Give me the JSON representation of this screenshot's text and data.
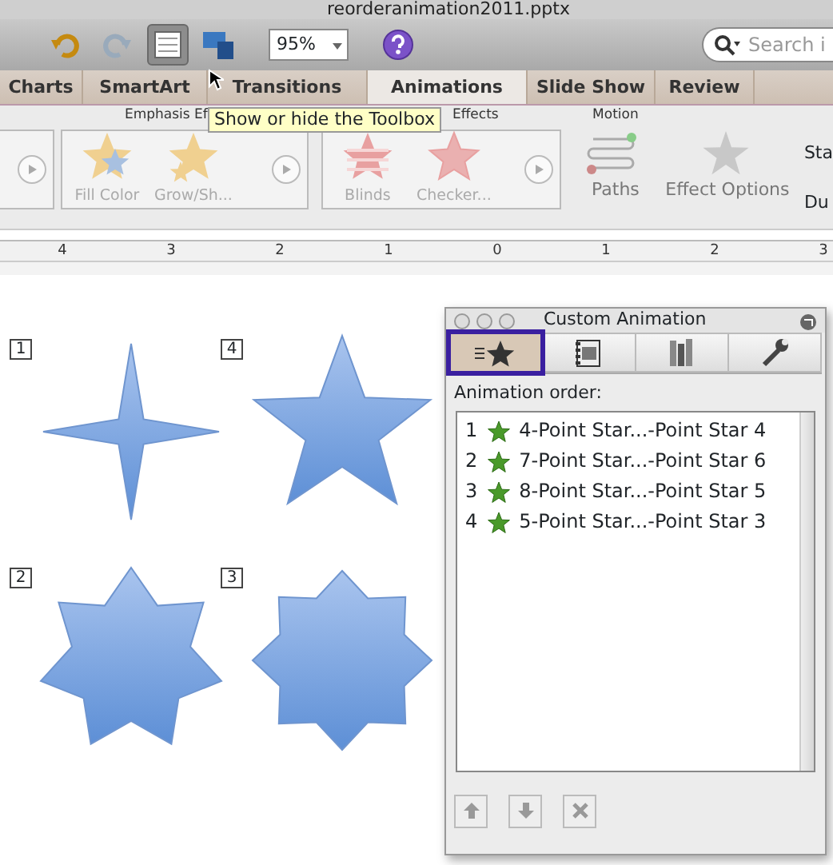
{
  "window": {
    "title": "reorderanimation2011.pptx"
  },
  "toolbar": {
    "zoom": "95%",
    "search": {
      "placeholder": "Search i"
    },
    "toolbox_pressed": true
  },
  "tooltip": "Show or hide the Toolbox",
  "tabs": [
    {
      "label": "Charts",
      "selected": false
    },
    {
      "label": "SmartArt",
      "selected": false
    },
    {
      "label": "Transitions",
      "selected": false
    },
    {
      "label": "Animations",
      "selected": true
    },
    {
      "label": "Slide Show",
      "selected": false
    },
    {
      "label": "Review",
      "selected": false
    }
  ],
  "ribbon": {
    "groups": [
      {
        "title": "Emphasis Ef",
        "items": [
          {
            "label": "Fill Color",
            "kind": "fill"
          },
          {
            "label": "Grow/Sh...",
            "kind": "grow"
          }
        ]
      },
      {
        "title": "Effects",
        "items": [
          {
            "label": "Blinds",
            "kind": "blinds"
          },
          {
            "label": "Checker...",
            "kind": "checker"
          }
        ]
      }
    ],
    "motion": {
      "title": "Motion",
      "button": "Paths"
    },
    "effect_options": "Effect Options",
    "side_labels": [
      "Sta",
      "Du"
    ]
  },
  "ruler": [
    "4",
    "3",
    "2",
    "1",
    "0",
    "1",
    "2",
    "3"
  ],
  "slide": {
    "shapes": [
      {
        "number": "1",
        "kind": "star4"
      },
      {
        "number": "4",
        "kind": "star5"
      },
      {
        "number": "2",
        "kind": "star7"
      },
      {
        "number": "3",
        "kind": "star8"
      }
    ]
  },
  "panel": {
    "title": "Custom Animation",
    "tabs": [
      {
        "selected": true
      },
      {
        "selected": false
      },
      {
        "selected": false
      },
      {
        "selected": false
      }
    ],
    "order_label": "Animation order:",
    "items": [
      {
        "number": "1",
        "name": "4-Point Star...-Point Star 4"
      },
      {
        "number": "2",
        "name": "7-Point Star...-Point Star 6"
      },
      {
        "number": "3",
        "name": "8-Point Star...-Point Star 5"
      },
      {
        "number": "4",
        "name": "5-Point Star...-Point Star 3"
      }
    ]
  }
}
